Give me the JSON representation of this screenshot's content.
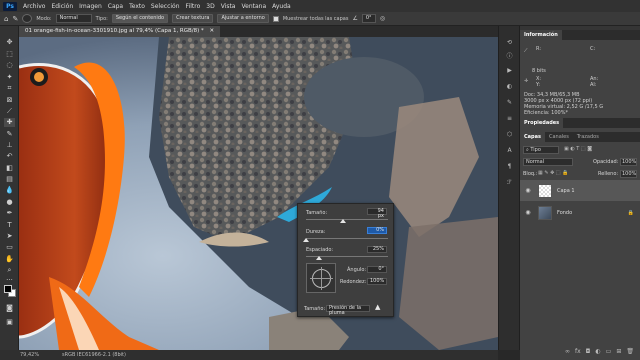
{
  "app": {
    "logo": "Ps"
  },
  "menu": [
    "Archivo",
    "Edición",
    "Imagen",
    "Capa",
    "Texto",
    "Selección",
    "Filtro",
    "3D",
    "Vista",
    "Ventana",
    "Ayuda"
  ],
  "options": {
    "mode_label": "Modo:",
    "mode_value": "Normal",
    "type_label": "Tipo:",
    "sample_button": "Según el contenido",
    "texture_button": "Crear textura",
    "proximity_button": "Ajustar a entorno",
    "sample_all_label": "Muestrear todas las capas",
    "angle_value": "0°"
  },
  "document": {
    "tab_title": "01 orange-fish-in-ocean-3301910.jpg al 79,4% (Capa 1, RGB/8) *"
  },
  "status": {
    "zoom": "79,42%",
    "profile": "sRGB IEC61966-2.1 (8bit)"
  },
  "brush_popup": {
    "size_label": "Tamaño:",
    "size_value": "94 px",
    "size_fraction": 0.4,
    "hardness_label": "Dureza:",
    "hardness_value": "0%",
    "hardness_fraction": 0.0,
    "spacing_label": "Espaciado:",
    "spacing_value": "25%",
    "spacing_fraction": 0.25,
    "angle_label": "Ángulo:",
    "angle_value": "0°",
    "roundness_label": "Redondez:",
    "roundness_value": "100%",
    "pressure_label": "Tamaño:",
    "pressure_value": "Presión de la pluma"
  },
  "info_panel": {
    "title": "Información",
    "doc_line": "Doc: 34,3 MB/65,3 MB",
    "size_line": "3000 px x 4000 px (72 ppi)",
    "memory_line": "Memoria virtual: 2,52 G /17,5 G",
    "efficiency_line": "Eficiencia: 100%*",
    "r_label": "R:",
    "c_label": "C:",
    "bits_label": "8 bits",
    "x_label": "X:",
    "y_label": "Y:",
    "w_label": "An:",
    "h_label": "Al:"
  },
  "properties_tab": "Propiedades",
  "layers_panel": {
    "tabs": [
      "Capas",
      "Canales",
      "Trazados"
    ],
    "filter_value": "Tipo",
    "blend_value": "Normal",
    "opacity_label": "Opacidad:",
    "opacity_value": "100%",
    "lock_label": "Bloq.:",
    "fill_label": "Relleno:",
    "fill_value": "100%",
    "layers": [
      {
        "name": "Capa 1",
        "selected": true
      },
      {
        "name": "Fondo",
        "selected": false
      }
    ],
    "footer_icons": [
      "link-icon",
      "fx-icon",
      "mask-icon",
      "adjustment-icon",
      "folder-icon",
      "new-layer-icon",
      "trash-icon"
    ]
  },
  "colors": {
    "fg": "#000000",
    "bg": "#ffffff",
    "accent": "#39a7ff"
  }
}
